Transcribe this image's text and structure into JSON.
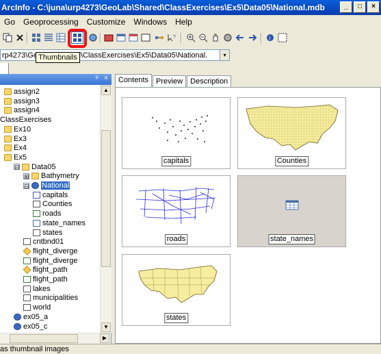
{
  "window": {
    "title": "ArcInfo - C:\\juna\\urp4273\\GeoLab\\Shared\\ClassExercises\\Ex5\\Data05\\National.mdb",
    "controls": [
      "_",
      "□",
      "×"
    ]
  },
  "menu": {
    "items": [
      "Go",
      "Geoprocessing",
      "Customize",
      "Windows",
      "Help"
    ]
  },
  "location": {
    "value": "rp4273\\GeoLab\\Shared\\ClassExercises\\Ex5\\Data05\\National.",
    "dropdown": "▾"
  },
  "tooltip": {
    "text": "Thumbnails"
  },
  "tree_header": {
    "pin": "ᵖ",
    "close": "×"
  },
  "tree": {
    "items": [
      {
        "label": "assign2",
        "icon": "folder-icon"
      },
      {
        "label": "assign3",
        "icon": "folder-icon"
      },
      {
        "label": "assign4",
        "icon": "folder-icon"
      },
      {
        "label": "ClassExercises",
        "icon": ""
      },
      {
        "label": "Ex10",
        "icon": "folder-icon"
      },
      {
        "label": "Ex3",
        "icon": "folder-icon"
      },
      {
        "label": "Ex4",
        "icon": "folder-icon"
      },
      {
        "label": "Ex5",
        "icon": "folder-icon"
      },
      {
        "label": "Data05",
        "icon": "folder-icon",
        "expander": "⊟"
      },
      {
        "label": "Bathymetry",
        "icon": "folder-icon",
        "expander": "⊞"
      },
      {
        "label": "National",
        "icon": "gdb-icon",
        "expander": "⊟"
      },
      {
        "label": "capitals",
        "icon": "point-feature-icon"
      },
      {
        "label": "Counties",
        "icon": "polygon-feature-icon"
      },
      {
        "label": "roads",
        "icon": "line-feature-icon"
      },
      {
        "label": "state_names",
        "icon": "table-icon"
      },
      {
        "label": "states",
        "icon": "polygon-feature-icon"
      },
      {
        "label": "cntbnd01",
        "icon": "polygon-feature-icon"
      },
      {
        "label": "flight_diverge",
        "icon": "raster-icon"
      },
      {
        "label": "flight_diverge",
        "icon": "line-feature-icon"
      },
      {
        "label": "flight_path",
        "icon": "raster-icon"
      },
      {
        "label": "flight_path",
        "icon": "line-feature-icon"
      },
      {
        "label": "lakes",
        "icon": "polygon-feature-icon"
      },
      {
        "label": "municipalities",
        "icon": "polygon-feature-icon"
      },
      {
        "label": "world",
        "icon": "polygon-feature-icon"
      },
      {
        "label": "ex05_a",
        "icon": "globe-icon"
      },
      {
        "label": "ex05_c",
        "icon": "globe-icon"
      }
    ]
  },
  "tabs": [
    "Contents",
    "Preview",
    "Description"
  ],
  "thumbnails": [
    {
      "label": "capitals"
    },
    {
      "label": "Counties"
    },
    {
      "label": "roads"
    },
    {
      "label": "state_names"
    },
    {
      "label": "states"
    }
  ],
  "status": {
    "text": "as thumbnail images"
  },
  "colors": {
    "title_bar": "#0a50cf",
    "highlight": "#ee1111",
    "selection": "#316ac5",
    "map_fill": "#f6ee9e",
    "road_line": "#2a2ad6"
  }
}
